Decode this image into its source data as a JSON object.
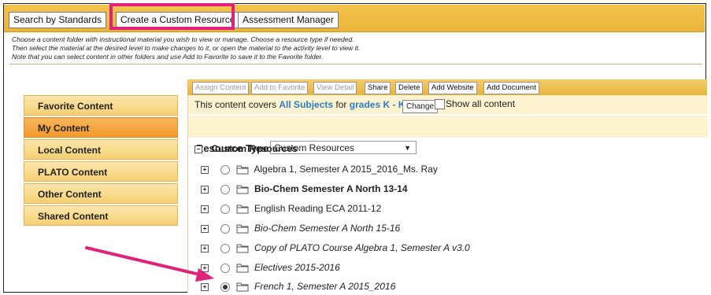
{
  "tabs": [
    {
      "label": "Search by Standards"
    },
    {
      "label": "Create a Custom Resource"
    },
    {
      "label": "Assessment Manager"
    }
  ],
  "instructions": [
    "Choose a content folder with instructional material you wish to view or manage. Choose a resource type if needed.",
    "Then select the material at the desired level to make changes to it, or open the material to the activity level to view it.",
    "Note that you can select content in other folders and use Add to Favorite to save it to the Favorite folder."
  ],
  "sidebar": {
    "items": [
      {
        "label": "Favorite Content"
      },
      {
        "label": "My Content"
      },
      {
        "label": "Local Content"
      },
      {
        "label": "PLATO Content"
      },
      {
        "label": "Other Content"
      },
      {
        "label": "Shared Content"
      }
    ]
  },
  "toolbar": {
    "buttons": [
      {
        "label": "Assign Content"
      },
      {
        "label": "Add to Favorite"
      },
      {
        "label": "View Detail"
      },
      {
        "label": "Share"
      },
      {
        "label": "Delete"
      },
      {
        "label": "Add Website"
      },
      {
        "label": "Add Document"
      }
    ]
  },
  "covers": {
    "prefix": "This content covers",
    "subjects": "All Subjects",
    "for": "for",
    "grades": "grades K - K.",
    "change": "Change",
    "show_all": "Show all content"
  },
  "resource_type": {
    "label": "Resource Type:",
    "value": "Custom Resources"
  },
  "tree": {
    "root": "Custom Resources",
    "items": [
      {
        "label": "Algebra 1, Semester A 2015_2016_Ms. Ray"
      },
      {
        "label": "Bio-Chem Semester A North 13-14"
      },
      {
        "label": "English Reading ECA 2011-12"
      },
      {
        "label": "Bio-Chem Semester A North 15-16"
      },
      {
        "label": "Copy of PLATO Course Algebra 1, Semester A v3.0"
      },
      {
        "label": "Electives 2015-2016"
      },
      {
        "label": "French 1, Semester A 2015_2016"
      }
    ]
  },
  "colors": {
    "highlight": "#e0237a",
    "link": "#2d7fc3",
    "tab_bar": "#eab43a"
  }
}
